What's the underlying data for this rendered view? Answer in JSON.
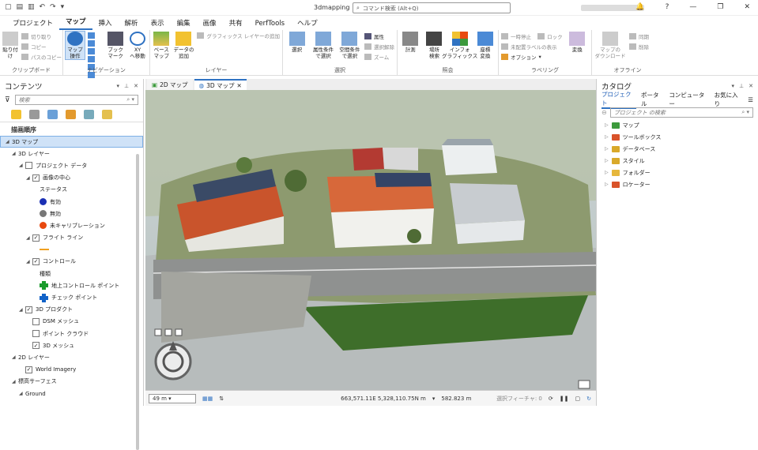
{
  "titlebar": {
    "title": "3dmapping",
    "command_search_placeholder": "コマンド検索 (Alt+Q)",
    "help": "?"
  },
  "menu": [
    "プロジェクト",
    "マップ",
    "挿入",
    "解析",
    "表示",
    "編集",
    "画像",
    "共有",
    "PerfTools",
    "ヘルプ"
  ],
  "active_menu": "マップ",
  "ribbon": {
    "clipboard": {
      "label": "クリップボード",
      "paste": "貼り付け",
      "cut": "切り取り",
      "copy": "コピー",
      "copy_path": "パスのコピー"
    },
    "navigation": {
      "label": "ナビゲーション",
      "explore": "マップ\n操作",
      "bookmarks": "ブック\nマーク",
      "goto_xy": "XY\nへ移動"
    },
    "layer": {
      "label": "レイヤー",
      "basemap": "ベース\nマップ",
      "add_data": "データの\n追加",
      "add_graphics": "グラフィックス レイヤーの追加"
    },
    "selection": {
      "label": "選択",
      "select": "選択",
      "select_by_attr": "属性条件\nで選択",
      "select_by_loc": "空間条件\nで選択",
      "attributes": "属性",
      "clear": "選択解除",
      "zoom": "ズーム"
    },
    "inquiry": {
      "label": "照会",
      "measure": "計測",
      "locate": "場所\n検索",
      "infographics": "インフォ\nグラフィックス",
      "convert_coords": "座標\n変換"
    },
    "labeling": {
      "label": "ラベリング",
      "pause": "一時停止",
      "lock": "ロック",
      "unplaced": "未配置ラベルの表示",
      "options": "オプション",
      "convert": "変換"
    },
    "offline": {
      "label": "オフライン",
      "download_map": "マップの\nダウンロード",
      "sync": "同期",
      "remove": "削除"
    }
  },
  "contents": {
    "title": "コンテンツ",
    "search_placeholder": "検索",
    "drawing_order": "描画順序",
    "rows": [
      {
        "indent": 0,
        "tri": "◢",
        "cb": "",
        "text": "3D マップ",
        "sel": true
      },
      {
        "indent": 1,
        "tri": "◢",
        "cb": "",
        "text": "3D レイヤー"
      },
      {
        "indent": 2,
        "tri": "◢",
        "cb": "empty",
        "text": "プロジェクト データ"
      },
      {
        "indent": 3,
        "tri": "◢",
        "cb": "checked",
        "text": "画像の中心"
      },
      {
        "indent": 4,
        "tri": "",
        "cb": "",
        "text": "ステータス"
      },
      {
        "indent": 4,
        "tri": "",
        "cb": "",
        "dot": "#1a2fb4",
        "text": "有効"
      },
      {
        "indent": 4,
        "tri": "",
        "cb": "",
        "dot": "#777777",
        "text": "無効"
      },
      {
        "indent": 4,
        "tri": "",
        "cb": "",
        "dot": "#e8490f",
        "text": "未キャリブレーション"
      },
      {
        "indent": 3,
        "tri": "◢",
        "cb": "checked",
        "text": "フライト ライン"
      },
      {
        "indent": 4,
        "tri": "",
        "cb": "",
        "line": "#f0a020",
        "text": ""
      },
      {
        "indent": 3,
        "tri": "◢",
        "cb": "checked",
        "text": "コントロール"
      },
      {
        "indent": 4,
        "tri": "",
        "cb": "",
        "text": "種類"
      },
      {
        "indent": 4,
        "tri": "",
        "cb": "",
        "cross": "green",
        "text": "地上コントロール ポイント"
      },
      {
        "indent": 4,
        "tri": "",
        "cb": "",
        "cross": "blue",
        "text": "チェック ポイント"
      },
      {
        "indent": 2,
        "tri": "◢",
        "cb": "checked",
        "text": "3D プロダクト"
      },
      {
        "indent": 3,
        "tri": "",
        "cb": "empty",
        "text": "DSM メッシュ"
      },
      {
        "indent": 3,
        "tri": "",
        "cb": "empty",
        "text": "ポイント クラウド"
      },
      {
        "indent": 3,
        "tri": "",
        "cb": "checked",
        "text": "3D メッシュ"
      },
      {
        "indent": 1,
        "tri": "◢",
        "cb": "",
        "text": "2D レイヤー"
      },
      {
        "indent": 2,
        "tri": "",
        "cb": "checked",
        "text": "World Imagery"
      },
      {
        "indent": 1,
        "tri": "◢",
        "cb": "",
        "text": "標高サーフェス"
      },
      {
        "indent": 2,
        "tri": "◢",
        "cb": "",
        "text": "Ground"
      }
    ]
  },
  "map": {
    "tabs": [
      {
        "label": "2D マップ",
        "active": false
      },
      {
        "label": "3D マップ",
        "active": true
      }
    ],
    "scale": "49 m",
    "coords": "663,571.11E 5,328,110.75N m",
    "elevation": "582.823 m",
    "selected_features": "選択フィーチャ: 0"
  },
  "catalog": {
    "title": "カタログ",
    "tabs": [
      "プロジェクト",
      "ポータル",
      "コンピューター",
      "お気に入り"
    ],
    "search_placeholder": "プロジェクト の検索",
    "items": [
      {
        "label": "マップ",
        "color": "#3c9a3c"
      },
      {
        "label": "ツールボックス",
        "color": "#d9532a"
      },
      {
        "label": "データベース",
        "color": "#d9a92a"
      },
      {
        "label": "スタイル",
        "color": "#d9a92a"
      },
      {
        "label": "フォルダー",
        "color": "#e6b73c"
      },
      {
        "label": "ロケーター",
        "color": "#d9532a"
      }
    ]
  }
}
